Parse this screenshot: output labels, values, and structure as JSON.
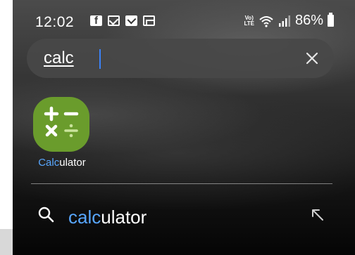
{
  "status_bar": {
    "time": "12:02",
    "volte_label_top": "Vo)",
    "volte_label_bottom": "LTE",
    "battery_percent": "86%",
    "notification_icons": [
      "facebook-icon",
      "message-icon",
      "mail-icon",
      "gallery-icon"
    ]
  },
  "search": {
    "query": "calc",
    "clear_icon": "close-icon"
  },
  "app_result": {
    "label_match": "Calc",
    "label_rest": "ulator",
    "icon": "calculator-icon",
    "icon_color": "#6a9c2c"
  },
  "suggestion": {
    "text_match": "calc",
    "text_rest": "ulator",
    "highlight_color": "#58a7ff"
  }
}
